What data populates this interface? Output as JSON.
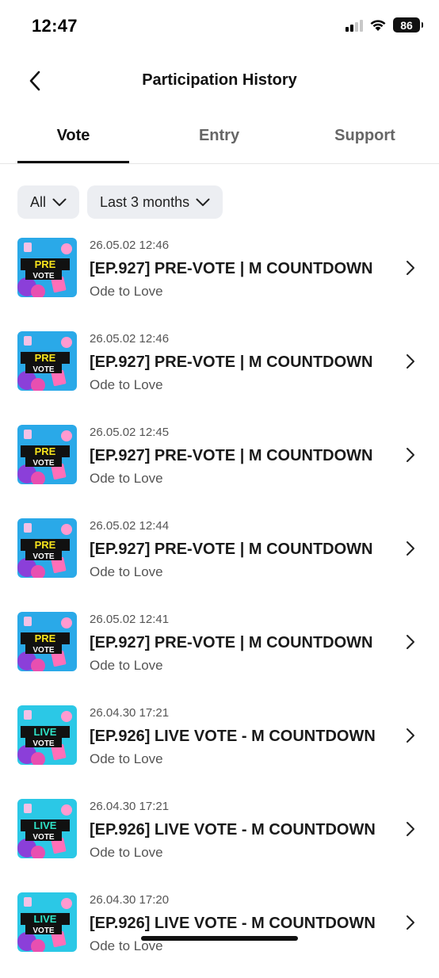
{
  "status_bar": {
    "time": "12:47",
    "battery": "86"
  },
  "header": {
    "title": "Participation History"
  },
  "tabs": [
    {
      "label": "Vote",
      "active": true
    },
    {
      "label": "Entry",
      "active": false
    },
    {
      "label": "Support",
      "active": false
    }
  ],
  "filters": {
    "type": {
      "selected": "All"
    },
    "period": {
      "selected": "Last 3 months"
    }
  },
  "items": [
    {
      "date": "26.05.02 12:46",
      "title": "[EP.927] PRE-VOTE | M COUNTDOWN",
      "subtitle": "Ode to Love",
      "thumb": {
        "line1": "PRE",
        "line2": "VOTE",
        "kind": "pre"
      }
    },
    {
      "date": "26.05.02 12:46",
      "title": "[EP.927] PRE-VOTE | M COUNTDOWN",
      "subtitle": "Ode to Love",
      "thumb": {
        "line1": "PRE",
        "line2": "VOTE",
        "kind": "pre"
      }
    },
    {
      "date": "26.05.02 12:45",
      "title": "[EP.927] PRE-VOTE | M COUNTDOWN",
      "subtitle": "Ode to Love",
      "thumb": {
        "line1": "PRE",
        "line2": "VOTE",
        "kind": "pre"
      }
    },
    {
      "date": "26.05.02 12:44",
      "title": "[EP.927] PRE-VOTE | M COUNTDOWN",
      "subtitle": "Ode to Love",
      "thumb": {
        "line1": "PRE",
        "line2": "VOTE",
        "kind": "pre"
      }
    },
    {
      "date": "26.05.02 12:41",
      "title": "[EP.927] PRE-VOTE | M COUNTDOWN",
      "subtitle": "Ode to Love",
      "thumb": {
        "line1": "PRE",
        "line2": "VOTE",
        "kind": "pre"
      }
    },
    {
      "date": "26.04.30 17:21",
      "title": "[EP.926] LIVE VOTE - M COUNTDOWN",
      "subtitle": "Ode to Love",
      "thumb": {
        "line1": "LIVE",
        "line2": "VOTE",
        "kind": "live"
      }
    },
    {
      "date": "26.04.30 17:21",
      "title": "[EP.926] LIVE VOTE - M COUNTDOWN",
      "subtitle": "Ode to Love",
      "thumb": {
        "line1": "LIVE",
        "line2": "VOTE",
        "kind": "live"
      }
    },
    {
      "date": "26.04.30 17:20",
      "title": "[EP.926] LIVE VOTE - M COUNTDOWN",
      "subtitle": "Ode to Love",
      "thumb": {
        "line1": "LIVE",
        "line2": "VOTE",
        "kind": "live"
      }
    }
  ],
  "colors": {
    "pre_bg": "#2aa9e8",
    "live_bg": "#2bc8e6",
    "pre_label": "#f7e31c",
    "live_label": "#2fe3c7",
    "chip_bg": "#eceef2"
  },
  "icons": {
    "back": "chevron-left-icon",
    "row": "chevron-right-icon",
    "filter": "chevron-down-icon"
  }
}
